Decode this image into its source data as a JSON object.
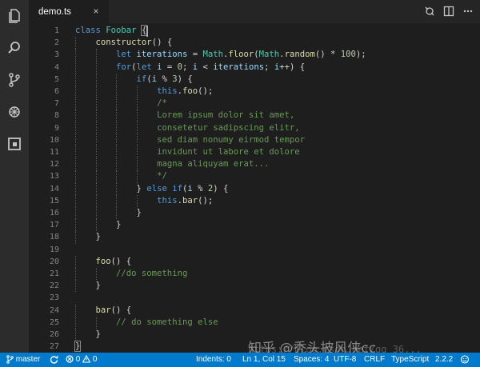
{
  "tab": {
    "label": "demo.ts",
    "close": "×"
  },
  "icons": {
    "activity": [
      "files-icon",
      "search-icon",
      "source-control-icon",
      "debug-icon",
      "extensions-icon"
    ],
    "tab_actions": [
      "open-changes-icon",
      "split-editor-icon",
      "more-icon"
    ]
  },
  "colors": {
    "keyword": "#569cd6",
    "class": "#4ec9b0",
    "function": "#dcdcaa",
    "variable": "#9cdcfe",
    "number": "#b5cea8",
    "comment": "#6a9955",
    "statusbar": "#007acc"
  },
  "editor": {
    "lines": [
      {
        "n": "1",
        "indent": 0,
        "tokens": [
          [
            "kw",
            "class "
          ],
          [
            "cls",
            "Foobar"
          ],
          [
            "p",
            " "
          ],
          [
            "hl",
            "{"
          ]
        ]
      },
      {
        "n": "2",
        "indent": 1,
        "tokens": [
          [
            "fn",
            "constructor"
          ],
          [
            "p",
            "() {"
          ]
        ]
      },
      {
        "n": "3",
        "indent": 2,
        "tokens": [
          [
            "kw",
            "let "
          ],
          [
            "var",
            "iterations"
          ],
          [
            "p",
            " = "
          ],
          [
            "cls",
            "Math"
          ],
          [
            "p",
            "."
          ],
          [
            "fn",
            "floor"
          ],
          [
            "p",
            "("
          ],
          [
            "cls",
            "Math"
          ],
          [
            "p",
            "."
          ],
          [
            "fn",
            "random"
          ],
          [
            "p",
            "() * "
          ],
          [
            "num",
            "100"
          ],
          [
            "p",
            ");"
          ]
        ]
      },
      {
        "n": "4",
        "indent": 2,
        "tokens": [
          [
            "kw",
            "for"
          ],
          [
            "p",
            "("
          ],
          [
            "kw",
            "let "
          ],
          [
            "var",
            "i"
          ],
          [
            "p",
            " = "
          ],
          [
            "num",
            "0"
          ],
          [
            "p",
            "; "
          ],
          [
            "var",
            "i"
          ],
          [
            "p",
            " < "
          ],
          [
            "var",
            "iterations"
          ],
          [
            "p",
            "; "
          ],
          [
            "var",
            "i"
          ],
          [
            "p",
            "++) {"
          ]
        ]
      },
      {
        "n": "5",
        "indent": 3,
        "tokens": [
          [
            "kw",
            "if"
          ],
          [
            "p",
            "("
          ],
          [
            "var",
            "i"
          ],
          [
            "p",
            " % "
          ],
          [
            "num",
            "3"
          ],
          [
            "p",
            ") {"
          ]
        ]
      },
      {
        "n": "6",
        "indent": 4,
        "tokens": [
          [
            "kw",
            "this"
          ],
          [
            "p",
            "."
          ],
          [
            "fn",
            "foo"
          ],
          [
            "p",
            "();"
          ]
        ]
      },
      {
        "n": "7",
        "indent": 4,
        "tokens": [
          [
            "cm",
            "/*"
          ]
        ]
      },
      {
        "n": "8",
        "indent": 4,
        "tokens": [
          [
            "cm",
            "Lorem ipsum dolor sit amet,"
          ]
        ]
      },
      {
        "n": "9",
        "indent": 4,
        "tokens": [
          [
            "cm",
            "consetetur sadipscing elitr,"
          ]
        ]
      },
      {
        "n": "10",
        "indent": 4,
        "tokens": [
          [
            "cm",
            "sed diam nonumy eirmod tempor"
          ]
        ]
      },
      {
        "n": "11",
        "indent": 4,
        "tokens": [
          [
            "cm",
            "invidunt ut labore et dolore"
          ]
        ]
      },
      {
        "n": "12",
        "indent": 4,
        "tokens": [
          [
            "cm",
            "magna aliquyam erat..."
          ]
        ]
      },
      {
        "n": "13",
        "indent": 4,
        "tokens": [
          [
            "cm",
            "*/"
          ]
        ]
      },
      {
        "n": "14",
        "indent": 3,
        "tokens": [
          [
            "p",
            "} "
          ],
          [
            "kw",
            "else if"
          ],
          [
            "p",
            "("
          ],
          [
            "var",
            "i"
          ],
          [
            "p",
            " % "
          ],
          [
            "num",
            "2"
          ],
          [
            "p",
            ") {"
          ]
        ]
      },
      {
        "n": "15",
        "indent": 4,
        "tokens": [
          [
            "kw",
            "this"
          ],
          [
            "p",
            "."
          ],
          [
            "fn",
            "bar"
          ],
          [
            "p",
            "();"
          ]
        ]
      },
      {
        "n": "16",
        "indent": 3,
        "tokens": [
          [
            "p",
            "}"
          ]
        ]
      },
      {
        "n": "17",
        "indent": 2,
        "tokens": [
          [
            "p",
            "}"
          ]
        ]
      },
      {
        "n": "18",
        "indent": 1,
        "tokens": [
          [
            "p",
            "}"
          ]
        ]
      },
      {
        "n": "19",
        "indent": 0,
        "tokens": []
      },
      {
        "n": "20",
        "indent": 1,
        "tokens": [
          [
            "fn",
            "foo"
          ],
          [
            "p",
            "() {"
          ]
        ]
      },
      {
        "n": "21",
        "indent": 2,
        "tokens": [
          [
            "cm",
            "//do something"
          ]
        ]
      },
      {
        "n": "22",
        "indent": 1,
        "tokens": [
          [
            "p",
            "}"
          ]
        ]
      },
      {
        "n": "23",
        "indent": 0,
        "tokens": []
      },
      {
        "n": "24",
        "indent": 1,
        "tokens": [
          [
            "fn",
            "bar"
          ],
          [
            "p",
            "() {"
          ]
        ]
      },
      {
        "n": "25",
        "indent": 2,
        "tokens": [
          [
            "cm",
            "// do something else"
          ]
        ]
      },
      {
        "n": "26",
        "indent": 1,
        "tokens": [
          [
            "p",
            "}"
          ]
        ]
      },
      {
        "n": "27",
        "indent": 0,
        "tokens": [
          [
            "hl",
            "}"
          ]
        ]
      }
    ]
  },
  "statusbar": {
    "branch": "master",
    "errors": "0",
    "warnings": "0",
    "indents": "Indents: 0",
    "position": "Ln 1, Col 15",
    "spaces": "Spaces: 4",
    "encoding": "UTF-8",
    "eol": "CRLF",
    "language": "TypeScript",
    "version": "2.2.2"
  },
  "watermark": {
    "main": "知乎 @秃头披风侠cc",
    "sub": "https://blog.csdn.net/qq_36..."
  }
}
